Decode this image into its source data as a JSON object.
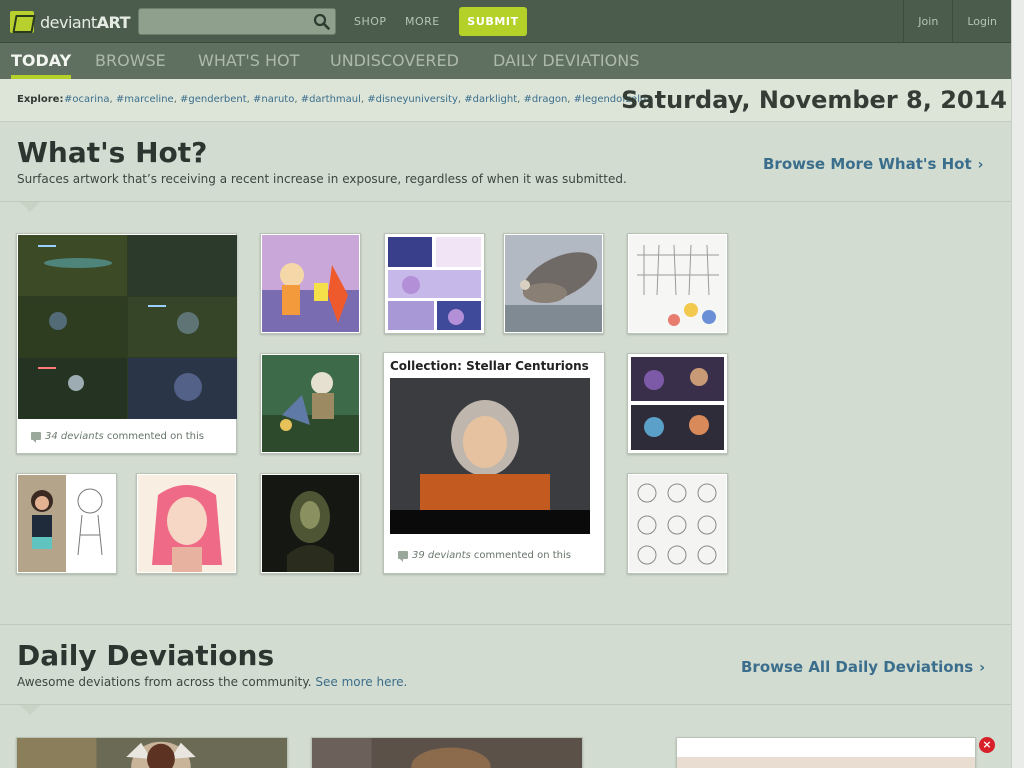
{
  "header": {
    "logo_text_light": "deviant",
    "logo_text_bold": "ART",
    "search": {
      "value": "",
      "placeholder": ""
    },
    "links": [
      "SHOP",
      "MORE"
    ],
    "submit_label": "SUBMIT",
    "account": [
      "Join",
      "Login"
    ]
  },
  "nav": {
    "tabs": [
      "TODAY",
      "BROWSE",
      "WHAT'S HOT",
      "UNDISCOVERED",
      "DAILY DEVIATIONS"
    ],
    "active": "TODAY"
  },
  "explore": {
    "label": "Explore:",
    "tags": [
      "#ocarina",
      "#marceline",
      "#genderbent",
      "#naruto",
      "#darthmaul",
      "#disneyuniversity",
      "#darklight",
      "#dragon",
      "#legendofzelda"
    ]
  },
  "date": "Saturday, November 8, 2014",
  "whats_hot": {
    "title": "What's Hot?",
    "subtitle": "Surfaces artwork that’s receiving a recent increase in exposure, regardless of when it was submitted.",
    "browse_link": "Browse More What's Hot",
    "featured_card": {
      "count_text": "34 deviants",
      "suffix": "commented on this"
    },
    "collection_card": {
      "title": "Collection: Stellar Centurions",
      "count_text": "39 deviants",
      "suffix": "commented on this"
    }
  },
  "daily": {
    "title": "Daily Deviations",
    "subtitle": "Awesome deviations from across the community.",
    "see_more": "See more here.",
    "browse_link": "Browse All Daily Deviations"
  },
  "colors": {
    "accent": "#b4d12a",
    "link": "#3b6e8c",
    "topbar": "#4b5c4c",
    "navbar": "#5f6f60",
    "page_bg": "#d3dcd0"
  },
  "icons": {
    "search": "search-icon",
    "comment": "comment-bubble-icon",
    "chevron": "chevron-right-icon",
    "close": "close-icon"
  }
}
